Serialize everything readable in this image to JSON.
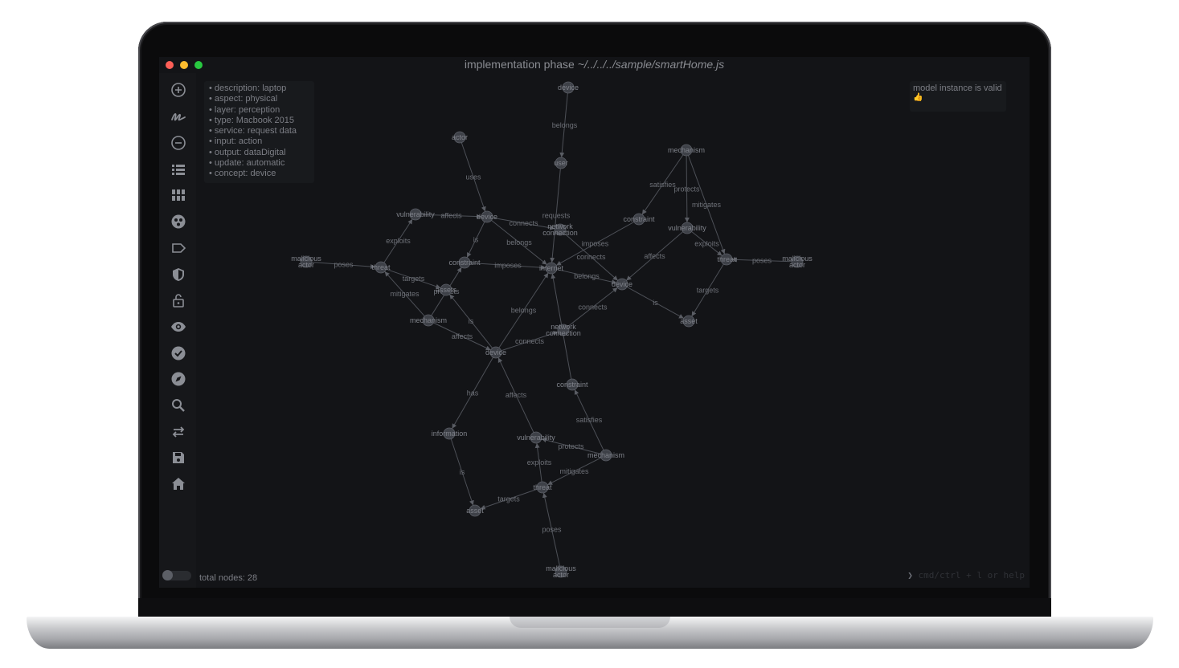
{
  "window": {
    "title_prefix": "implementation phase ",
    "title_path": "~/../../../sample/smartHome.js",
    "traffic_colors": [
      "#fe5f57",
      "#febc2e",
      "#28c840"
    ]
  },
  "sidebar": {
    "buttons": [
      "plus-circle",
      "scribble",
      "minus-circle",
      "list-view",
      "grid-view",
      "group-view",
      "label-tag",
      "shield",
      "lock",
      "eye",
      "check-circle",
      "compass",
      "search",
      "swap",
      "save",
      "home"
    ]
  },
  "info_panel": [
    "• description: laptop",
    "• aspect: physical",
    "• layer: perception",
    "• type: Macbook 2015",
    "• service: request data",
    "• input: action",
    "• output: dataDigital",
    "• update: automatic",
    "• concept: device"
  ],
  "validation": {
    "message": "model instance is valid",
    "icon": "👍"
  },
  "status": {
    "total_nodes": "total nodes: 28",
    "prompt_symbol": "❯",
    "command_hint": "cmd/ctrl + l or help"
  },
  "graph": {
    "nodes": [
      {
        "id": "n1",
        "label": "device"
      },
      {
        "id": "n2",
        "label": "user"
      },
      {
        "id": "n3",
        "label": "actor"
      },
      {
        "id": "n4",
        "label": "mechanism"
      },
      {
        "id": "n5",
        "label": "vulnerability"
      },
      {
        "id": "n6",
        "label": "device"
      },
      {
        "id": "n7",
        "label": "network\nconnection"
      },
      {
        "id": "n8",
        "label": "constraint"
      },
      {
        "id": "n9",
        "label": "vulnerability"
      },
      {
        "id": "n10",
        "label": "malicious\nactor"
      },
      {
        "id": "n11",
        "label": "threat"
      },
      {
        "id": "n12",
        "label": "constraint"
      },
      {
        "id": "n13",
        "label": "internet"
      },
      {
        "id": "n14",
        "label": "threat"
      },
      {
        "id": "n15",
        "label": "malicious\nactor"
      },
      {
        "id": "n16",
        "label": "assets"
      },
      {
        "id": "n17",
        "label": "device"
      },
      {
        "id": "n18",
        "label": "mechanism"
      },
      {
        "id": "n19",
        "label": "asset"
      },
      {
        "id": "n20",
        "label": "network\nconnection"
      },
      {
        "id": "n21",
        "label": "device"
      },
      {
        "id": "n22",
        "label": "constraint"
      },
      {
        "id": "n23",
        "label": "information"
      },
      {
        "id": "n24",
        "label": "vulnerability"
      },
      {
        "id": "n25",
        "label": "mechanism"
      },
      {
        "id": "n26",
        "label": "threat"
      },
      {
        "id": "n27",
        "label": "asset"
      },
      {
        "id": "n28",
        "label": "malicious\nactor"
      }
    ],
    "edges": [
      {
        "from": "n1",
        "to": "n2",
        "label": "belongs"
      },
      {
        "from": "n3",
        "to": "n6",
        "label": "uses"
      },
      {
        "from": "n2",
        "to": "n13",
        "label": "requests"
      },
      {
        "from": "n4",
        "to": "n8",
        "label": "satisfies"
      },
      {
        "from": "n4",
        "to": "n9",
        "label": "protects"
      },
      {
        "from": "n5",
        "to": "n6",
        "label": "affects"
      },
      {
        "from": "n6",
        "to": "n7",
        "label": "connects"
      },
      {
        "from": "n6",
        "to": "n13",
        "label": "belongs"
      },
      {
        "from": "n6",
        "to": "n12",
        "label": "is"
      },
      {
        "from": "n8",
        "to": "n13",
        "label": "imposes"
      },
      {
        "from": "n9",
        "to": "n14",
        "label": "exploits"
      },
      {
        "from": "n9",
        "to": "n17",
        "label": "affects"
      },
      {
        "from": "n4",
        "to": "n14",
        "label": "mitigates"
      },
      {
        "from": "n10",
        "to": "n11",
        "label": "poses"
      },
      {
        "from": "n11",
        "to": "n5",
        "label": "exploits"
      },
      {
        "from": "n11",
        "to": "n16",
        "label": "targets"
      },
      {
        "from": "n12",
        "to": "n13",
        "label": "imposes"
      },
      {
        "from": "n18",
        "to": "n11",
        "label": "mitigates"
      },
      {
        "from": "n18",
        "to": "n12",
        "label": "protects"
      },
      {
        "from": "n7",
        "to": "n17",
        "label": "connects"
      },
      {
        "from": "n13",
        "to": "n17",
        "label": "belongs"
      },
      {
        "from": "n15",
        "to": "n14",
        "label": "poses"
      },
      {
        "from": "n14",
        "to": "n19",
        "label": "targets"
      },
      {
        "from": "n17",
        "to": "n19",
        "label": "is"
      },
      {
        "from": "n18",
        "to": "n21",
        "label": "affects"
      },
      {
        "from": "n21",
        "to": "n16",
        "label": "is"
      },
      {
        "from": "n21",
        "to": "n13",
        "label": "belongs"
      },
      {
        "from": "n21",
        "to": "n20",
        "label": "connects"
      },
      {
        "from": "n20",
        "to": "n17",
        "label": "connects"
      },
      {
        "from": "n22",
        "to": "n13",
        "label": ""
      },
      {
        "from": "n21",
        "to": "n23",
        "label": "has"
      },
      {
        "from": "n24",
        "to": "n21",
        "label": "affects"
      },
      {
        "from": "n25",
        "to": "n22",
        "label": "satisfies"
      },
      {
        "from": "n25",
        "to": "n24",
        "label": "protects"
      },
      {
        "from": "n23",
        "to": "n27",
        "label": "is"
      },
      {
        "from": "n26",
        "to": "n24",
        "label": "exploits"
      },
      {
        "from": "n26",
        "to": "n27",
        "label": "targets"
      },
      {
        "from": "n28",
        "to": "n26",
        "label": "poses"
      },
      {
        "from": "n25",
        "to": "n26",
        "label": "mitigates"
      }
    ]
  }
}
